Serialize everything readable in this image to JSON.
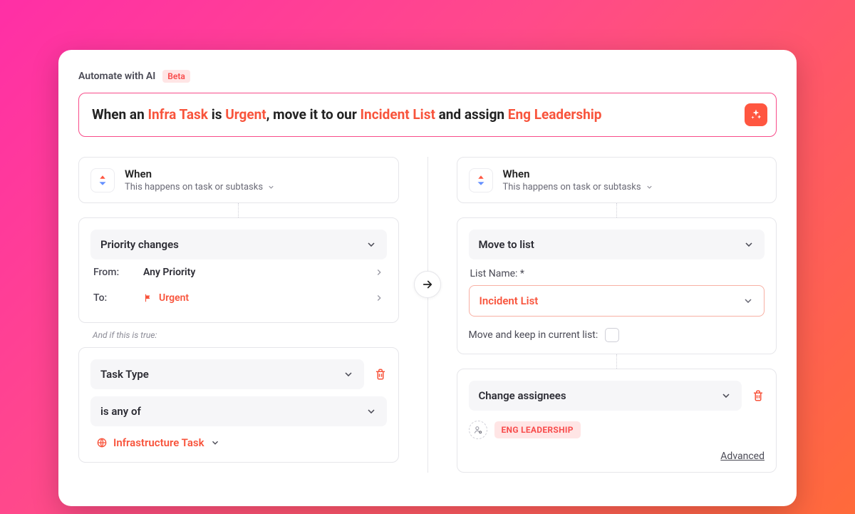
{
  "header": {
    "title": "Automate with AI",
    "badge": "Beta"
  },
  "prompt": {
    "pre1": "When an ",
    "hl1": "Infra Task",
    "mid1": " is ",
    "hl2": "Urgent",
    "mid2": ", move it to our ",
    "hl3": "Incident List",
    "mid3": " and assign ",
    "hl4": "Eng Leadership"
  },
  "left": {
    "when_title": "When",
    "when_sub": "This happens on task or subtasks",
    "trigger": "Priority changes",
    "from_label": "From:",
    "from_value": "Any Priority",
    "to_label": "To:",
    "to_value": "Urgent",
    "and_if": "And if this is true:",
    "cond_field": "Task Type",
    "cond_op": "is any of",
    "cond_value": "Infrastructure Task"
  },
  "right": {
    "when_title": "When",
    "when_sub": "This happens on task or subtasks",
    "action1": "Move to list",
    "list_name_label": "List Name: *",
    "list_value": "Incident List",
    "keep_label": "Move and keep in current list:",
    "action2": "Change assignees",
    "assignee": "ENG LEADERSHIP",
    "advanced": "Advanced"
  }
}
